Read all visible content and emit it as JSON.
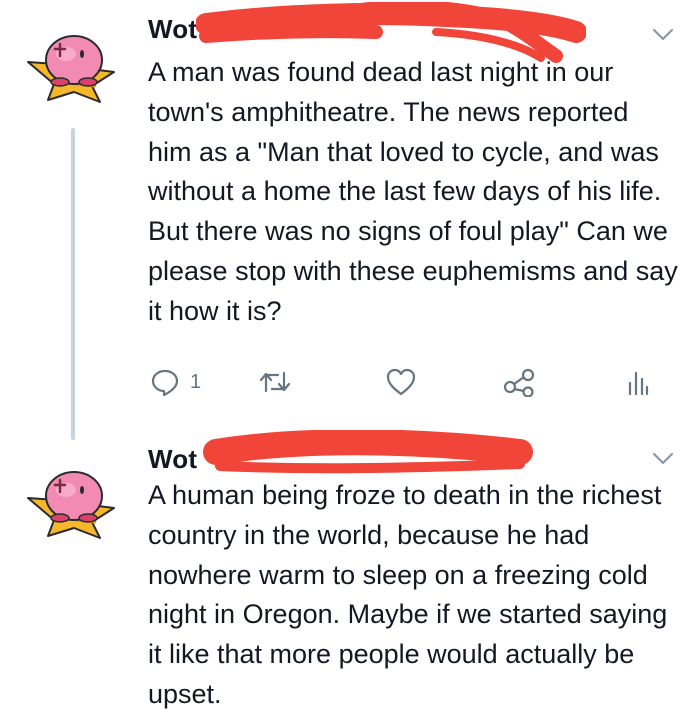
{
  "colors": {
    "text": "#141823",
    "icon": "#66757f",
    "thread_line": "#c9d3dd",
    "redaction": "#f2453a",
    "avatar_pink": "#f28bb3",
    "avatar_star": "#f6b82a"
  },
  "tweets": [
    {
      "author_name": "Wot",
      "avatar_icon": "kirby-on-warp-star-avatar",
      "text": "A man was found dead last night in our town's amphitheatre. The news reported him as a \"Man that loved to cycle, and was without a home the last few days of his life. But there was no signs of foul play\" Can we please stop with these euphemisms and say it how it is?",
      "actions": {
        "reply_count": "1",
        "reply_icon": "reply-icon",
        "retweet_icon": "retweet-icon",
        "like_icon": "heart-icon",
        "share_icon": "share-icon",
        "analytics_icon": "analytics-icon"
      }
    },
    {
      "author_name": "Wot",
      "avatar_icon": "kirby-on-warp-star-avatar",
      "text": "A human being froze to death in the richest country in the world, because he had nowhere warm to sleep on a freezing cold night in Oregon. Maybe if we started saying it like that more people would actually be upset."
    }
  ]
}
